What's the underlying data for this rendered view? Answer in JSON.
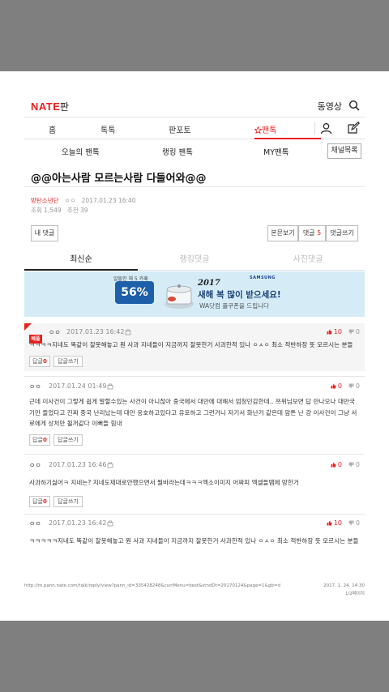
{
  "header": {
    "logo": "NATE",
    "logo_sub": "판",
    "video_link": "동영상"
  },
  "nav": {
    "tabs": [
      "홈",
      "톡톡",
      "판포토",
      "팬톡"
    ],
    "active_tab": "팬톡",
    "sub_tabs": [
      "오늘의 팬톡",
      "랭킹 팬톡",
      "MY팬톡"
    ],
    "channel_button": "채널목록"
  },
  "post": {
    "title": "@@아는사람 모르는사람 다들어와@@",
    "author": "방탄소년단",
    "nick": "ㅇㅇ",
    "date": "2017.01.23 16:40",
    "views": "조회 1,549",
    "likes": "추천 39"
  },
  "actions": {
    "my_comments": "내 댓글",
    "view_body": "본문보기",
    "comments_label": "댓글",
    "comments_count": "5",
    "write_comment": "댓글쓰기"
  },
  "sort": {
    "tabs": [
      "최신순",
      "랭킹댓글",
      "사진댓글"
    ],
    "active": "최신순"
  },
  "banner": {
    "brand": "SAMSUNG",
    "sale_text": "알뜰한 해 5 카페",
    "discount": "56%",
    "year": "2017",
    "headline": "새해 복 많이 받으세요!",
    "subline": "WA닷컴 플쿠폰을 드립니다"
  },
  "comments": [
    {
      "best": true,
      "best_label": "베플",
      "nick": "ㅇㅇ",
      "date": "2017.01.23 16:42",
      "up": "10",
      "down": "0",
      "text": "ㅋㅋㅋㅋ지네도 똑같이 잘못해놓고 뭔 사과 지네들이 지금까지 잘못한거 사과한적 있나 ㅇㅅㅇ 최소 적반하장 뜻 모르시는 분들",
      "reply_label": "답글",
      "reply_count": "0",
      "reply_write": "답글쓰기"
    },
    {
      "best": false,
      "nick": "ㅇㅇ",
      "date": "2017.01.24 01:49",
      "up": "0",
      "down": "0",
      "text": "근데 이사건이 그렇게 쉽게 말할수있는 사건이 아니잖아 중국에서 대만에 대해서 엄청민감한데.. 쯔위님보면 답 만나오나 대만국기만 들었다고 진짜 중국 난리났는데 대만 옹호하고있다고 유포하고 그런거니 저기서 화난거 같은데 암튼 난 걍 이사건이 그냥 서로에게 상처만 될꺼같다 이뻐들 힘내",
      "reply_label": "답글",
      "reply_count": "0",
      "reply_write": "답글쓰기"
    },
    {
      "best": false,
      "nick": "ㅇㅇ",
      "date": "2017.01.23 16:46",
      "up": "0",
      "down": "0",
      "text": "사과하기싫어ㅋ 지네는? 지네도제대로안했으면서 뭘바라는데ㅋㅋㅋ엑소이미지 어짜피 엑셀들땜에 망한거",
      "reply_label": "답글",
      "reply_count": "0",
      "reply_write": "답글쓰기"
    },
    {
      "best": false,
      "nick": "ㅇㅇ",
      "date": "2017.01.23 16:42",
      "up": "10",
      "down": "0",
      "text": "ㅋㅋㅋㅋㅋ지네도 똑같이 잘못해놓고 뭔 사과 지네들이 지금까지 잘못한거 사과한적 있나 ㅇㅅㅇ 최소 적반하장 뜻 모르시는 분들"
    }
  ],
  "footer": {
    "url": "http://m.pann.nate.com/talk/reply/view?pann_id=335428248&currMenu=best&stndDt=20170124&page=1&gb=d",
    "print_date": "2017. 1. 24. 14:30",
    "page_info": "1/2페이지"
  },
  "colors": {
    "accent": "#e8201f",
    "background": "#7f7f7f",
    "banner_bg": "#d5ecf7"
  }
}
